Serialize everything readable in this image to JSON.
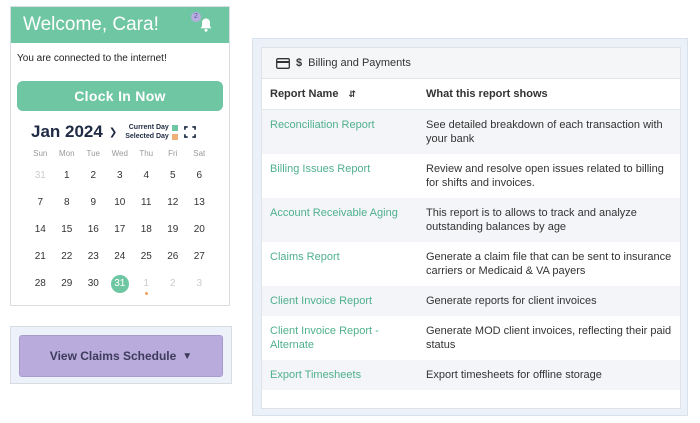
{
  "welcome": {
    "title": "Welcome, Cara!",
    "badge": "2"
  },
  "status": {
    "connected_text": "You are connected to the internet!"
  },
  "clock_in": {
    "label": "Clock In Now"
  },
  "calendar": {
    "month_label": "Jan 2024",
    "legend_current": "Current Day",
    "legend_selected": "Selected Day",
    "current_color": "#6fc6a3",
    "selected_color": "#f0b07a",
    "weekdays": [
      "Sun",
      "Mon",
      "Tue",
      "Wed",
      "Thu",
      "Fri",
      "Sat"
    ],
    "days": [
      {
        "n": "31",
        "muted": true
      },
      {
        "n": "1"
      },
      {
        "n": "2"
      },
      {
        "n": "3"
      },
      {
        "n": "4"
      },
      {
        "n": "5"
      },
      {
        "n": "6"
      },
      {
        "n": "7"
      },
      {
        "n": "8"
      },
      {
        "n": "9"
      },
      {
        "n": "10"
      },
      {
        "n": "11"
      },
      {
        "n": "12"
      },
      {
        "n": "13"
      },
      {
        "n": "14"
      },
      {
        "n": "15"
      },
      {
        "n": "16"
      },
      {
        "n": "17"
      },
      {
        "n": "18"
      },
      {
        "n": "19"
      },
      {
        "n": "20"
      },
      {
        "n": "21"
      },
      {
        "n": "22"
      },
      {
        "n": "23"
      },
      {
        "n": "24"
      },
      {
        "n": "25"
      },
      {
        "n": "26"
      },
      {
        "n": "27"
      },
      {
        "n": "28"
      },
      {
        "n": "29"
      },
      {
        "n": "30"
      },
      {
        "n": "31",
        "current": true
      },
      {
        "n": "1",
        "muted": true,
        "dot": true
      },
      {
        "n": "2",
        "muted": true
      },
      {
        "n": "3",
        "muted": true
      }
    ]
  },
  "claims": {
    "label": "View Claims Schedule"
  },
  "billing": {
    "header_title": "Billing and Payments",
    "col_name": "Report Name",
    "col_desc": "What this report shows",
    "rows": [
      {
        "name": "Reconciliation Report",
        "desc": "See detailed breakdown of each transaction with your bank"
      },
      {
        "name": "Billing Issues Report",
        "desc": "Review and resolve open issues related to billing for shifts and invoices."
      },
      {
        "name": "Account Receivable Aging",
        "desc": "This report is to allows to track and analyze outstanding balances by age"
      },
      {
        "name": "Claims Report",
        "desc": "Generate a claim file that can be sent to insurance carriers or Medicaid & VA payers"
      },
      {
        "name": "Client Invoice Report",
        "desc": "Generate reports for client invoices"
      },
      {
        "name": "Client Invoice Report - Alternate",
        "desc": "Generate MOD client invoices, reflecting their paid status"
      },
      {
        "name": "Export Timesheets",
        "desc": "Export timesheets for offline storage"
      }
    ]
  }
}
